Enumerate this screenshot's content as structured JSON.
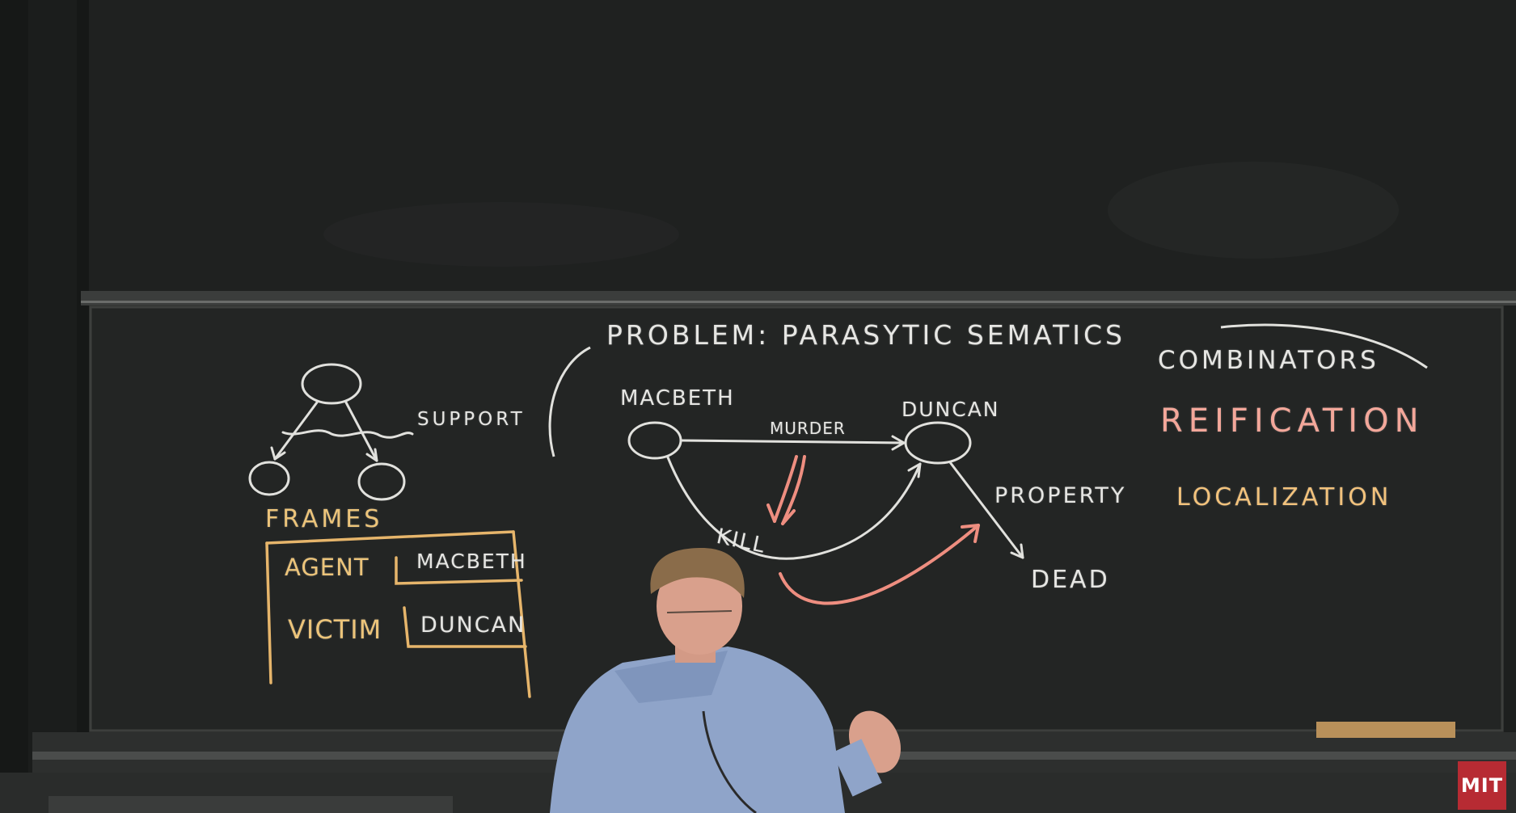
{
  "board": {
    "problem_text": "PROBLEM: PARASYTIC SEMATICS",
    "combinators_text": "COMBINATORS",
    "reification_text": "REIFICATION",
    "localization_text": "LOCALIZATION",
    "support_text": "SUPPORT",
    "frames_text": "FRAMES",
    "agent_label": "AGENT",
    "agent_value": "MACBETH",
    "victim_label": "VICTIM",
    "victim_value": "DUNCAN",
    "macbeth_text": "MACBETH",
    "duncan_text": "DUNCAN",
    "murder_text": "MURDER",
    "kill_text": "KILL",
    "property_text": "PROPERTY",
    "dead_text": "DEAD"
  },
  "logo": {
    "text": "MIT",
    "color": "#b72b33"
  },
  "colors": {
    "board": "#1d1f1e",
    "chalk_white": "#e6e6e3",
    "chalk_yellow": "#ecc47a",
    "chalk_pink": "#f3a79a",
    "shirt": "#8fa4c9"
  }
}
